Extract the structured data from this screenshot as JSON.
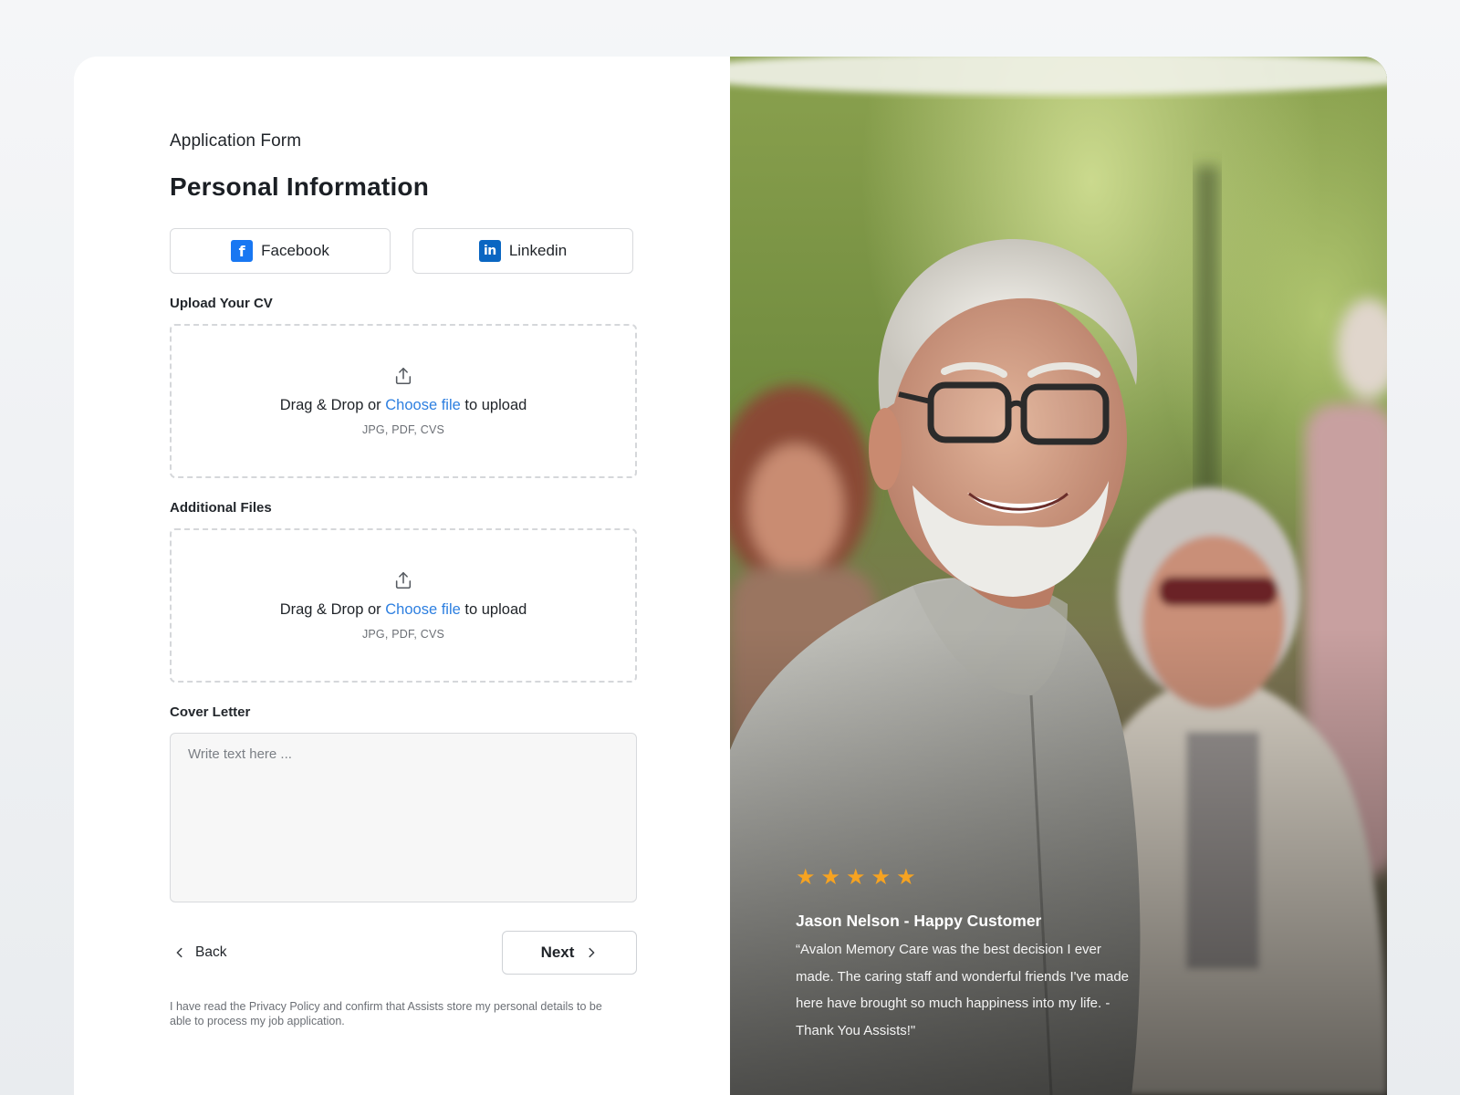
{
  "form": {
    "eyebrow": "Application Form",
    "title": "Personal Information",
    "social": {
      "facebook_label": "Facebook",
      "facebook_icon": "facebook-icon",
      "linkedin_label": "Linkedin",
      "linkedin_icon": "linkedin-icon"
    },
    "upload_cv": {
      "label": "Upload Your CV",
      "prefix": "Drag & Drop or",
      "link": "Choose file",
      "suffix": "to upload",
      "hint": "JPG, PDF, CVS"
    },
    "additional_files": {
      "label": "Additional Files",
      "prefix": "Drag & Drop or",
      "link": "Choose file",
      "suffix": "to upload",
      "hint": "JPG, PDF, CVS"
    },
    "cover_letter": {
      "label": "Cover Letter",
      "placeholder": "Write text here ...",
      "value": ""
    },
    "back_label": "Back",
    "next_label": "Next",
    "privacy_text": "I have read the Privacy Policy and confirm that Assists store my personal details to be able to process my job application."
  },
  "testimonial": {
    "rating": 5,
    "stars": [
      "★",
      "★",
      "★",
      "★",
      "★"
    ],
    "name": "Jason Nelson - Happy Customer",
    "quote": "“Avalon Memory Care was the best decision I ever made. The caring staff and wonderful friends I've made here have brought so much happiness into my life. - Thank You Assists!\"",
    "photo": "smiling-senior-man-with-friends-photo"
  },
  "colors": {
    "accent_link": "#2d7fe0",
    "facebook": "#1877f2",
    "linkedin": "#0a66c2",
    "star": "#f6a321"
  }
}
